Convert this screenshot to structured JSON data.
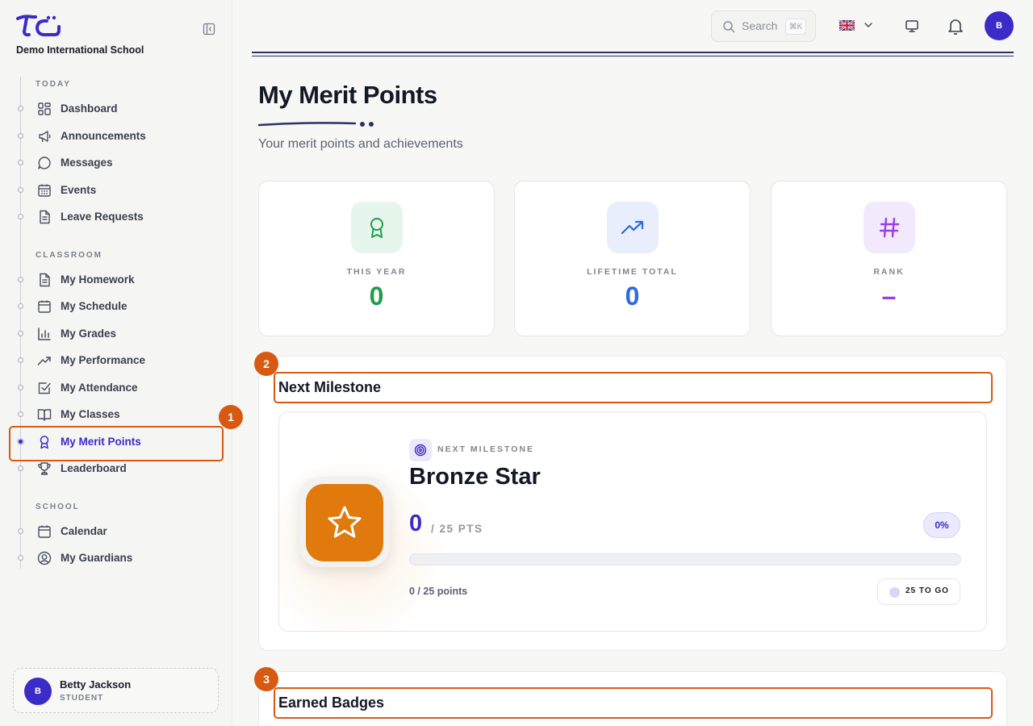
{
  "school": {
    "name": "Demo International School"
  },
  "sidebar": {
    "sections": [
      {
        "title": "TODAY",
        "items": [
          {
            "label": "Dashboard",
            "icon": "dashboard-icon"
          },
          {
            "label": "Announcements",
            "icon": "megaphone-icon"
          },
          {
            "label": "Messages",
            "icon": "message-icon"
          },
          {
            "label": "Events",
            "icon": "calendar-grid-icon"
          },
          {
            "label": "Leave Requests",
            "icon": "document-icon"
          }
        ]
      },
      {
        "title": "CLASSROOM",
        "items": [
          {
            "label": "My Homework",
            "icon": "document-icon"
          },
          {
            "label": "My Schedule",
            "icon": "calendar-icon"
          },
          {
            "label": "My Grades",
            "icon": "bar-chart-icon"
          },
          {
            "label": "My Performance",
            "icon": "trend-up-icon"
          },
          {
            "label": "My Attendance",
            "icon": "checkbox-icon"
          },
          {
            "label": "My Classes",
            "icon": "book-icon"
          },
          {
            "label": "My Merit Points",
            "icon": "award-icon",
            "active": true
          },
          {
            "label": "Leaderboard",
            "icon": "trophy-icon"
          }
        ]
      },
      {
        "title": "SCHOOL",
        "items": [
          {
            "label": "Calendar",
            "icon": "calendar-icon"
          },
          {
            "label": "My Guardians",
            "icon": "user-circle-icon"
          }
        ]
      }
    ]
  },
  "user": {
    "initial": "B",
    "name": "Betty Jackson",
    "role": "STUDENT"
  },
  "topbar": {
    "search_placeholder": "Search",
    "search_shortcut": "⌘K"
  },
  "page": {
    "title": "My Merit Points",
    "subtitle": "Your merit points and achievements"
  },
  "stats": [
    {
      "label": "THIS YEAR",
      "value": "0",
      "color": "#1f9d4c",
      "bg": "#e6f6ec",
      "icon": "award-icon"
    },
    {
      "label": "LIFETIME TOTAL",
      "value": "0",
      "color": "#2f6ae0",
      "bg": "#e8eefb",
      "icon": "trend-up-icon"
    },
    {
      "label": "RANK",
      "value": "–",
      "color": "#9a3ee6",
      "bg": "#f2e9fc",
      "icon": "hash-icon"
    }
  ],
  "milestone": {
    "section_title": "Next Milestone",
    "tag": "NEXT MILESTONE",
    "name": "Bronze Star",
    "current": "0",
    "target": "/ 25 PTS",
    "percent_label": "0%",
    "progress": 0,
    "points_text": "0 / 25 points",
    "to_go": "25 TO GO"
  },
  "badges": {
    "section_title": "Earned Badges"
  },
  "annotations": {
    "one": "1",
    "two": "2",
    "three": "3"
  },
  "colors": {
    "accent": "#3b2bc7",
    "highlight": "#d85a12",
    "star": "#e07a0c"
  }
}
